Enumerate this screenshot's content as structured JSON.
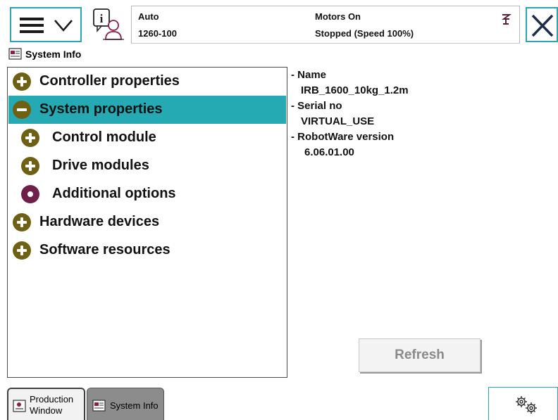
{
  "topbar": {
    "menu_icons": [
      "hamburger-icon",
      "chevron-down-icon"
    ],
    "info_icon": "info-user-icon",
    "mode": "Auto",
    "system_id": "1260-100",
    "motors": "Motors On",
    "state": "Stopped (Speed 100%)",
    "close_icon": "close-icon"
  },
  "app": {
    "title": "System Info"
  },
  "tree": {
    "items": [
      {
        "label": "Controller properties",
        "icon": "plus",
        "level": 0,
        "selected": false
      },
      {
        "label": "System properties",
        "icon": "minus",
        "level": 0,
        "selected": true
      },
      {
        "label": "Control module",
        "icon": "plus",
        "level": 1,
        "selected": false
      },
      {
        "label": "Drive modules",
        "icon": "plus",
        "level": 1,
        "selected": false
      },
      {
        "label": "Additional options",
        "icon": "bullet",
        "level": 1,
        "selected": false
      },
      {
        "label": "Hardware devices",
        "icon": "plus",
        "level": 0,
        "selected": false
      },
      {
        "label": "Software resources",
        "icon": "plus",
        "level": 0,
        "selected": false
      }
    ]
  },
  "details": {
    "name_label": "- Name",
    "name_value": "IRB_1600_10kg_1.2m",
    "serial_label": "- Serial no",
    "serial_value": "VIRTUAL_USE",
    "robotware_label": "- RobotWare version",
    "robotware_value": "6.06.01.00"
  },
  "refresh_label": "Refresh",
  "taskbar": {
    "production_line1": "Production",
    "production_line2": "Window",
    "system_info": "System Info",
    "settings_icon": "gears-icon"
  },
  "colors": {
    "accent": "#25a9b3",
    "plus_icon": "#706014",
    "bullet_icon": "#701e4a"
  }
}
